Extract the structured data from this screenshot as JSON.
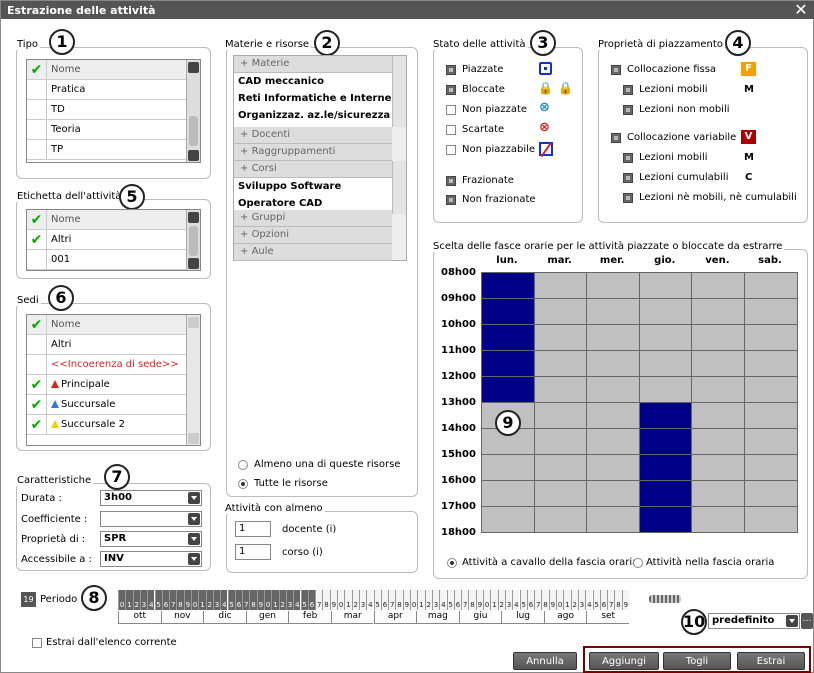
{
  "window": {
    "title": "Estrazione delle attività"
  },
  "tipo": {
    "label": "Tipo",
    "badge": "1",
    "header": "Nome",
    "items": [
      "Pratica",
      "TD",
      "Teoria",
      "TP"
    ]
  },
  "materie": {
    "label": "Materie e risorse",
    "badge": "2",
    "sections": {
      "materie": "Materie",
      "docenti": "Docenti",
      "raggruppamenti": "Raggruppamenti",
      "corsi": "Corsi",
      "gruppi": "Gruppi",
      "opzioni": "Opzioni",
      "aule": "Aule"
    },
    "materie_items": [
      "CAD meccanico",
      "Reti Informatiche e  Interne",
      "Organizzaz. az.le/sicurezza"
    ],
    "corsi_items": [
      "Sviluppo Software",
      "Operatore CAD"
    ],
    "radio_any": "Almeno una di queste risorse",
    "radio_all": "Tutte le risorse"
  },
  "stato": {
    "label": "Stato delle attività",
    "badge": "3",
    "items": [
      "Piazzate",
      "Bloccate",
      "Non piazzate",
      "Scartate",
      "Non piazzabile"
    ],
    "items2": [
      "Frazionate",
      "Non frazionate"
    ]
  },
  "proprieta": {
    "label": "Proprietà di piazzamento",
    "badge": "4",
    "fissa": "Collocazione fissa",
    "fissa_icon": "F",
    "fissa_sub": [
      "Lezioni mobili",
      "Lezioni non mobili"
    ],
    "fissa_sub_letter": "M",
    "variabile": "Collocazione variabile",
    "variabile_icon": "V",
    "var_sub": [
      "Lezioni mobili",
      "Lezioni cumulabili",
      "Lezioni nè mobili, nè cumulabili"
    ],
    "var_letters": [
      "M",
      "C"
    ]
  },
  "etichetta": {
    "label": "Etichetta dell'attività",
    "badge": "5",
    "header": "Nome",
    "items": [
      "Altri",
      "001"
    ]
  },
  "sedi": {
    "label": "Sedi",
    "badge": "6",
    "header": "Nome",
    "items": [
      "Altri",
      "<<Incoerenza di sede>>",
      "Principale",
      "Succursale",
      "Succursale 2"
    ],
    "colors": {
      "principale": "#dd2222",
      "succursale": "#3377dd",
      "succursale2": "#f0d000",
      "incoerenza": "#dd2222"
    }
  },
  "caratteristiche": {
    "label": "Caratteristiche",
    "badge": "7",
    "durata_label": "Durata :",
    "durata_value": "3h00",
    "coeff_label": "Coefficiente :",
    "coeff_value": "",
    "prop_label": "Proprietà di :",
    "prop_value": "SPR",
    "acc_label": "Accessibile a :",
    "acc_value": "INV"
  },
  "attivita": {
    "label": "Attività con almeno",
    "docente_value": "1",
    "docente_label": "docente (i)",
    "corso_value": "1",
    "corso_label": "corso (i)"
  },
  "fasce": {
    "label": "Scelta delle fasce orarie per le attività piazzate o bloccate da estrarre",
    "badge": "9",
    "days": [
      "lun.",
      "mar.",
      "mer.",
      "gio.",
      "ven.",
      "sab."
    ],
    "hours": [
      "08h00",
      "09h00",
      "10h00",
      "11h00",
      "12h00",
      "13h00",
      "14h00",
      "15h00",
      "16h00",
      "17h00",
      "18h00"
    ],
    "selected": [
      [
        0,
        0
      ],
      [
        0,
        1
      ],
      [
        0,
        2
      ],
      [
        0,
        3
      ],
      [
        0,
        4
      ],
      [
        3,
        5
      ],
      [
        3,
        6
      ],
      [
        3,
        7
      ],
      [
        3,
        8
      ],
      [
        3,
        9
      ]
    ],
    "radio_cavallo": "Attività a cavallo della fascia oraria",
    "radio_nella": "Attività nella fascia oraria",
    "fill_color": "#000088",
    "empty_color": "#c0c0c0"
  },
  "periodo": {
    "icon_text": "19",
    "label": "Periodo",
    "badge": "8",
    "digits": [
      "0",
      "1",
      "2",
      "3",
      "4",
      "5",
      "6",
      "7",
      "8",
      "9",
      "0",
      "1",
      "2",
      "3",
      "4",
      "5",
      "6",
      "7",
      "8",
      "9",
      "0",
      "1",
      "2",
      "3",
      "4",
      "5",
      "6",
      "7",
      "8",
      "9",
      "0",
      "1",
      "2",
      "3",
      "4",
      "5",
      "6",
      "7",
      "8",
      "9",
      "0",
      "1",
      "2",
      "3",
      "4",
      "5",
      "6",
      "7",
      "8",
      "9",
      "0",
      "1",
      "2",
      "3",
      "4",
      "5",
      "6",
      "7",
      "8",
      "9",
      "0",
      "1",
      "2",
      "3",
      "4",
      "5",
      "6",
      "7",
      "8",
      "9"
    ],
    "months": [
      "ott",
      "nov",
      "dic",
      "gen",
      "feb",
      "mar",
      "apr",
      "mag",
      "giu",
      "lug",
      "ago",
      "set"
    ],
    "dark_count": 27
  },
  "predefinito": {
    "badge": "10",
    "value": "predefinito"
  },
  "estrai_elenco": "Estrai dall'elenco corrente",
  "buttons": {
    "annulla": "Annulla",
    "aggiungi": "Aggiungi",
    "togli": "Togli",
    "estrai": "Estrai"
  }
}
